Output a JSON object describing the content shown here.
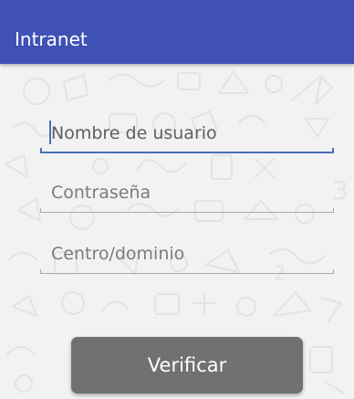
{
  "app_bar": {
    "title": "Intranet",
    "color": "#3f51b5"
  },
  "form": {
    "username": {
      "placeholder": "Nombre de usuario",
      "value": "",
      "focused": true
    },
    "password": {
      "placeholder": "Contraseña",
      "value": ""
    },
    "domain": {
      "placeholder": "Centro/dominio",
      "value": ""
    },
    "verify_label": "Verificar"
  },
  "background": {
    "pattern": "school-doodles"
  }
}
